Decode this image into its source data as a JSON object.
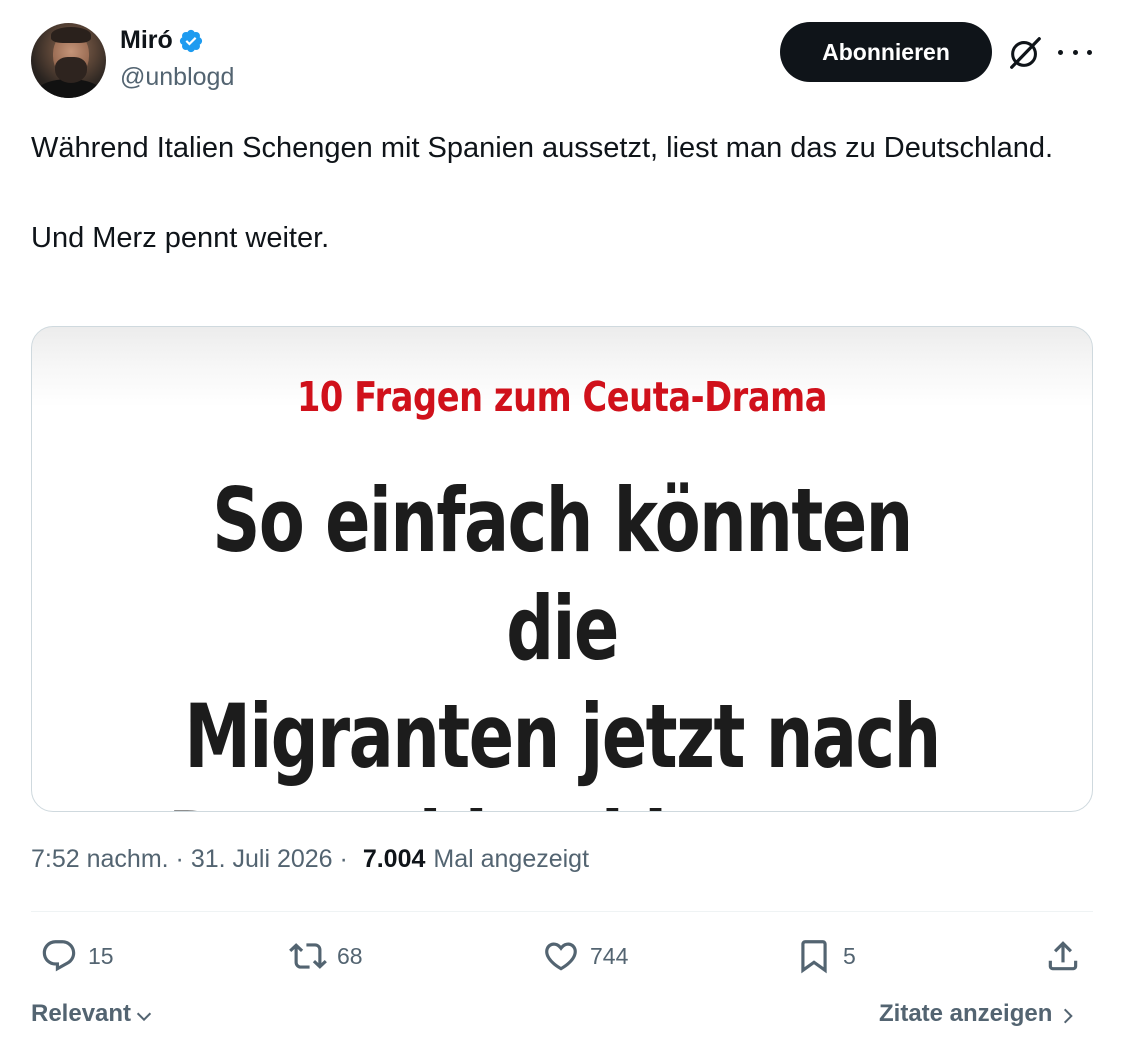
{
  "author": {
    "name": "Miró",
    "handle": "@unblogd",
    "verified": true,
    "verified_color": "#1d9bf0"
  },
  "header": {
    "follow_label": "Abonnieren",
    "grok_icon": "grok-icon",
    "more_icon": "more-icon"
  },
  "tweet": {
    "lines": [
      "Während Italien Schengen mit Spanien aussetzt, liest man das zu Deutschland.",
      "Und Merz pennt weiter."
    ]
  },
  "media": {
    "kicker": "10 Fragen zum Ceuta-Drama",
    "kicker_color": "#d0111b",
    "headline_lines": [
      "So einfach könnten die",
      "Migranten jetzt nach",
      "Deutschland kommen"
    ]
  },
  "meta": {
    "time": "7:52 nachm.",
    "separator": " · ",
    "date": "31. Juli 2026",
    "separator2": " · ",
    "views": "7.004",
    "views_label": "Mal angezeigt"
  },
  "actions": {
    "replies": "15",
    "retweets": "68",
    "likes": "744",
    "bookmarks": "5"
  },
  "footer": {
    "sort_label": "Relevant",
    "quotes_label": "Zitate anzeigen"
  }
}
